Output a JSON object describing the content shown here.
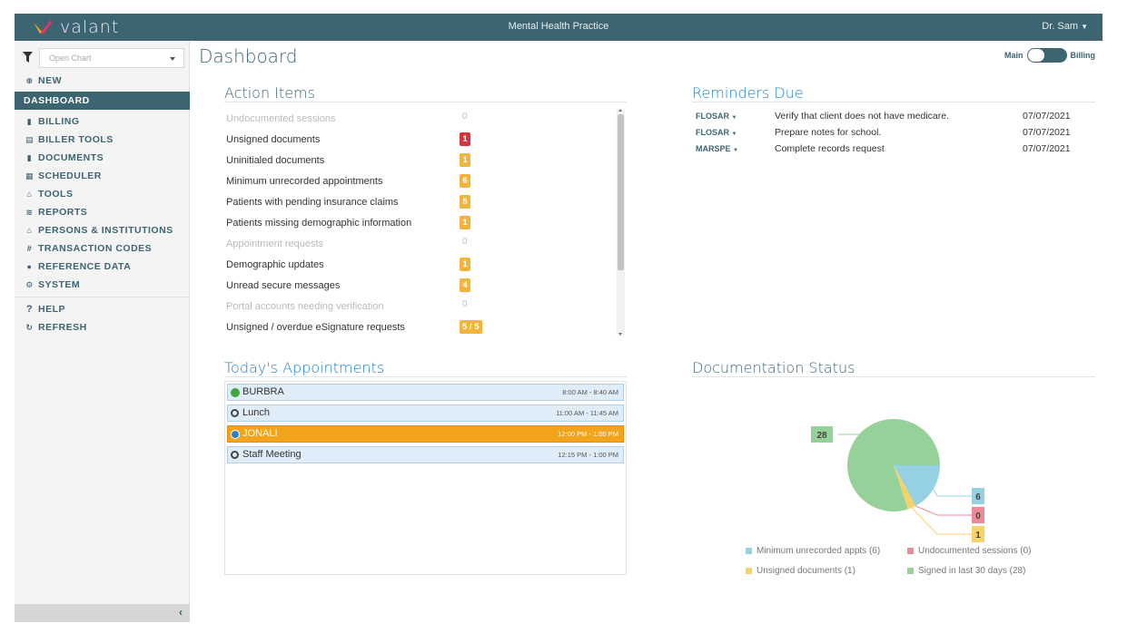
{
  "app": {
    "brand": "valant",
    "practice": "Mental Health Practice",
    "user": "Dr. Sam"
  },
  "sidebar": {
    "open_chart_placeholder": "Open Chart",
    "new_label": "NEW",
    "items": [
      {
        "label": "DASHBOARD",
        "icon": "none",
        "active": true
      },
      {
        "label": "BILLING",
        "icon": "billing-icon"
      },
      {
        "label": "BILLER TOOLS",
        "icon": "biller-tools-icon"
      },
      {
        "label": "DOCUMENTS",
        "icon": "documents-icon"
      },
      {
        "label": "SCHEDULER",
        "icon": "calendar-icon"
      },
      {
        "label": "TOOLS",
        "icon": "tools-icon"
      },
      {
        "label": "REPORTS",
        "icon": "reports-icon"
      },
      {
        "label": "PERSONS & INSTITUTIONS",
        "icon": "institution-icon"
      },
      {
        "label": "TRANSACTION CODES",
        "icon": "hash-icon"
      },
      {
        "label": "REFERENCE DATA",
        "icon": "info-icon"
      },
      {
        "label": "SYSTEM",
        "icon": "gears-icon"
      }
    ],
    "help_label": "HELP",
    "refresh_label": "REFRESH",
    "collapse_glyph": "‹"
  },
  "header": {
    "title": "Dashboard",
    "toggle_left": "Main",
    "toggle_right": "Billing"
  },
  "action_items": {
    "title": "Action Items",
    "rows": [
      {
        "label": "Undocumented sessions",
        "count": "0",
        "style": "dim"
      },
      {
        "label": "Unsigned documents",
        "count": "1",
        "style": "red"
      },
      {
        "label": "Uninitialed documents",
        "count": "1",
        "style": "yellow"
      },
      {
        "label": "Minimum unrecorded appointments",
        "count": "6",
        "style": "yellow"
      },
      {
        "label": "Patients with pending insurance claims",
        "count": "5",
        "style": "yellow"
      },
      {
        "label": "Patients missing demographic information",
        "count": "1",
        "style": "yellow"
      },
      {
        "label": "Appointment requests",
        "count": "0",
        "style": "dim"
      },
      {
        "label": "Demographic updates",
        "count": "1",
        "style": "yellow"
      },
      {
        "label": "Unread secure messages",
        "count": "4",
        "style": "yellow"
      },
      {
        "label": "Portal accounts needing verification",
        "count": "0",
        "style": "dim"
      },
      {
        "label": "Unsigned / overdue eSignature requests",
        "count": "5 / 5",
        "style": "yellow"
      }
    ]
  },
  "reminders": {
    "title": "Reminders Due",
    "rows": [
      {
        "who": "FLOSAR",
        "text": "Verify that client does not have medicare.",
        "date": "07/07/2021"
      },
      {
        "who": "FLOSAR",
        "text": "Prepare notes for school.",
        "date": "07/07/2021"
      },
      {
        "who": "MARSPE",
        "text": "Complete records request",
        "date": "07/07/2021"
      }
    ]
  },
  "appointments": {
    "title": "Today's Appointments",
    "rows": [
      {
        "name": "BURBRA",
        "time": "8:00 AM - 8:40 AM",
        "icon": "green",
        "active": false
      },
      {
        "name": "Lunch",
        "time": "11:00 AM - 11:45 AM",
        "icon": "ring",
        "active": false
      },
      {
        "name": "JONALI",
        "time": "12:00 PM - 1:00 PM",
        "icon": "blue",
        "active": true
      },
      {
        "name": "Staff Meeting",
        "time": "12:15 PM - 1:00 PM",
        "icon": "ring",
        "active": false
      }
    ]
  },
  "documentation": {
    "title": "Documentation Status",
    "colors": {
      "min": "#96d0e3",
      "undoc": "#ee8a97",
      "unsigned": "#f5d36a",
      "signed": "#97d19a"
    }
  },
  "chart_data": {
    "type": "pie",
    "categories": [
      "Minimum unrecorded appts (6)",
      "Undocumented sessions (0)",
      "Unsigned documents (1)",
      "Signed in last 30 days (28)"
    ],
    "values": [
      6,
      0,
      1,
      28
    ],
    "labels": [
      "6",
      "0",
      "1",
      "28"
    ],
    "legend": "bottom"
  }
}
